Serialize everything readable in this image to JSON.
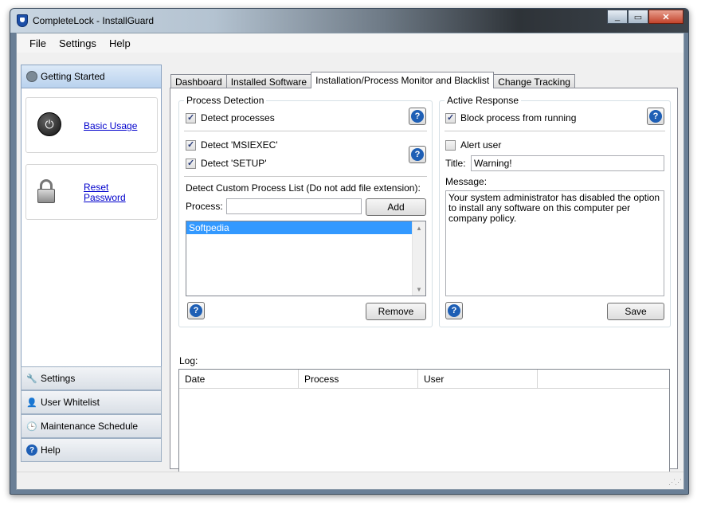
{
  "window": {
    "title": "CompleteLock - InstallGuard"
  },
  "menu": [
    "File",
    "Settings",
    "Help"
  ],
  "sidebar": {
    "header": "Getting Started",
    "cards": [
      {
        "icon": "power-icon",
        "link_line1": "Basic Usage",
        "link_line2": ""
      },
      {
        "icon": "lock-icon",
        "link_line1": "Reset",
        "link_line2": "Password"
      }
    ],
    "buttons": [
      {
        "label": "Settings",
        "icon": "wrench-icon"
      },
      {
        "label": "User Whitelist",
        "icon": "user-icon"
      },
      {
        "label": "Maintenance Schedule",
        "icon": "clock-icon"
      },
      {
        "label": "Help",
        "icon": "help-icon"
      }
    ]
  },
  "tabs": [
    "Dashboard",
    "Installed Software",
    "Installation/Process Monitor and Blacklist",
    "Change Tracking"
  ],
  "active_tab": 2,
  "process_detection": {
    "title": "Process Detection",
    "detect_processes": {
      "label": "Detect processes",
      "checked": true
    },
    "detect_msiexec": {
      "label": "Detect 'MSIEXEC'",
      "checked": true
    },
    "detect_setup": {
      "label": "Detect 'SETUP'",
      "checked": true
    },
    "custom_list_label": "Detect Custom Process List (Do not add file extension):",
    "process_label": "Process:",
    "process_value": "",
    "add_button": "Add",
    "list_items": [
      "Softpedia"
    ],
    "remove_button": "Remove"
  },
  "active_response": {
    "title": "Active Response",
    "block_process": {
      "label": "Block process from running",
      "checked": true
    },
    "alert_user": {
      "label": "Alert user",
      "checked": false
    },
    "title_label": "Title:",
    "title_value": "Warning!",
    "message_label": "Message:",
    "message_value": "Your system administrator has disabled the option to install any software on this computer per company policy.",
    "save_button": "Save"
  },
  "log": {
    "label": "Log:",
    "columns": [
      "Date",
      "Process",
      "User",
      ""
    ]
  }
}
